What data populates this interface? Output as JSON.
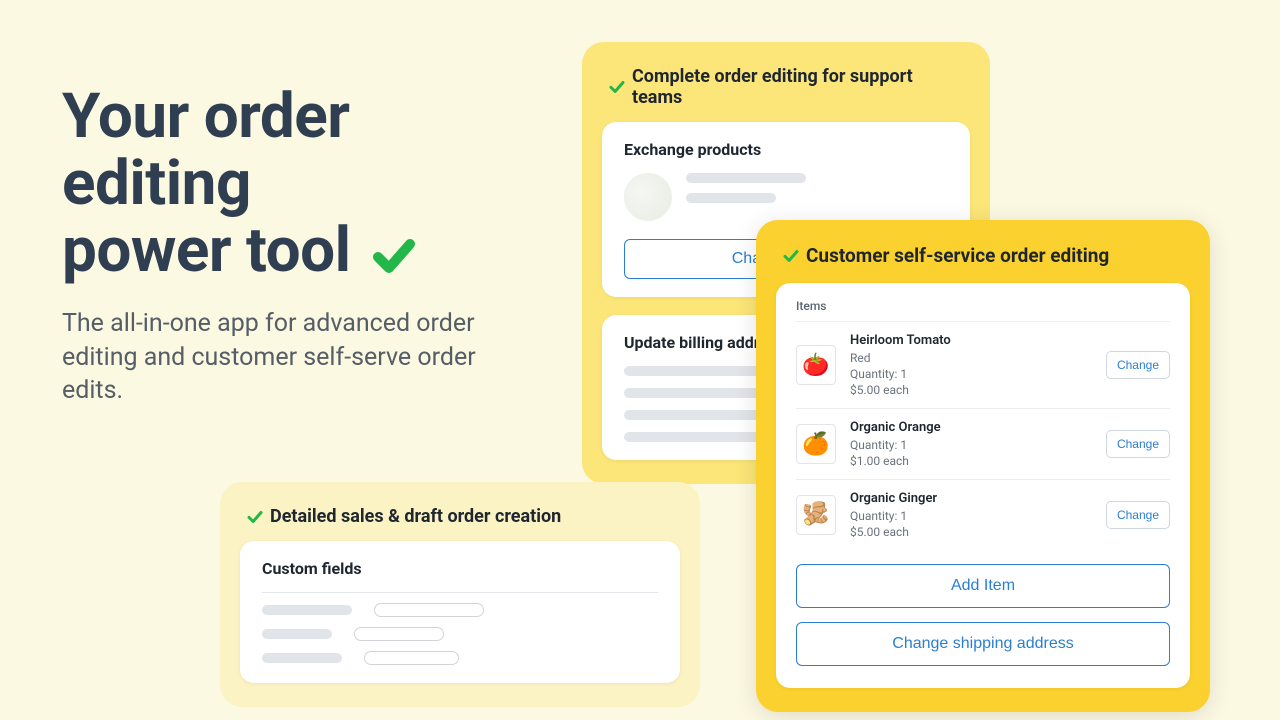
{
  "hero": {
    "title_line1": "Your order",
    "title_line2": "editing",
    "title_line3": "power tool",
    "subtitle": "The all-in-one app for advanced order editing and customer self-serve order edits."
  },
  "panel_a": {
    "title": "Detailed sales & draft order creation",
    "card_title": "Custom fields"
  },
  "panel_b": {
    "title": "Complete order editing for support teams",
    "card1_title": "Exchange products",
    "change_variant_label": "Change variant",
    "card2_title": "Update billing address"
  },
  "panel_c": {
    "title": "Customer self-service order editing",
    "items_label": "Items",
    "items": [
      {
        "emoji": "🍅",
        "name": "Heirloom Tomato",
        "variant": "Red",
        "qty": "Quantity: 1",
        "price": "$5.00 each"
      },
      {
        "emoji": "🍊",
        "name": "Organic Orange",
        "variant": "",
        "qty": "Quantity: 1",
        "price": "$1.00 each"
      },
      {
        "emoji": "🫚",
        "name": "Organic Ginger",
        "variant": "",
        "qty": "Quantity: 1",
        "price": "$5.00 each"
      }
    ],
    "change_label": "Change",
    "add_item_label": "Add Item",
    "change_shipping_label": "Change shipping address"
  }
}
